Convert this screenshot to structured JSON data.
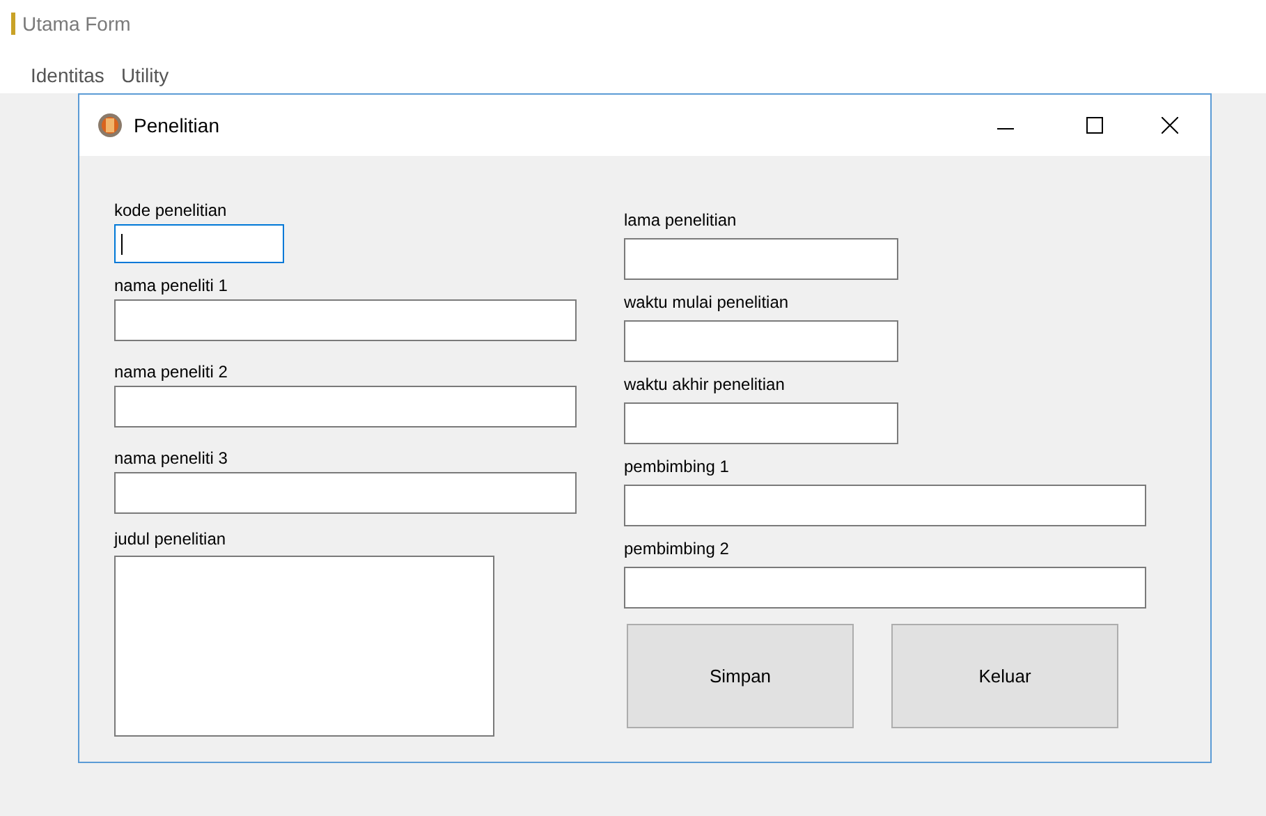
{
  "app": {
    "title": "Utama Form"
  },
  "menu": [
    {
      "label": "Identitas"
    },
    {
      "label": "Utility"
    }
  ],
  "dialog": {
    "title": "Penelitian",
    "left_fields": [
      {
        "kind": "text",
        "label": "kode penelitian",
        "focused": true
      },
      {
        "kind": "text",
        "label": "nama peneliti 1",
        "focused": false
      },
      {
        "kind": "text",
        "label": "nama peneliti 2",
        "focused": false
      },
      {
        "kind": "text",
        "label": "nama peneliti 3",
        "focused": false
      },
      {
        "kind": "textarea",
        "label": "judul penelitian",
        "focused": false
      }
    ],
    "right_fields": [
      {
        "kind": "text",
        "label": "lama penelitian",
        "focused": false
      },
      {
        "kind": "text",
        "label": "waktu mulai penelitian",
        "focused": false
      },
      {
        "kind": "text",
        "label": "waktu akhir penelitian",
        "focused": false
      },
      {
        "kind": "text",
        "label": "pembimbing 1",
        "focused": false
      },
      {
        "kind": "text",
        "label": "pembimbing 2",
        "focused": false
      }
    ],
    "buttons": [
      {
        "label": "Simpan"
      },
      {
        "label": "Keluar"
      }
    ]
  }
}
